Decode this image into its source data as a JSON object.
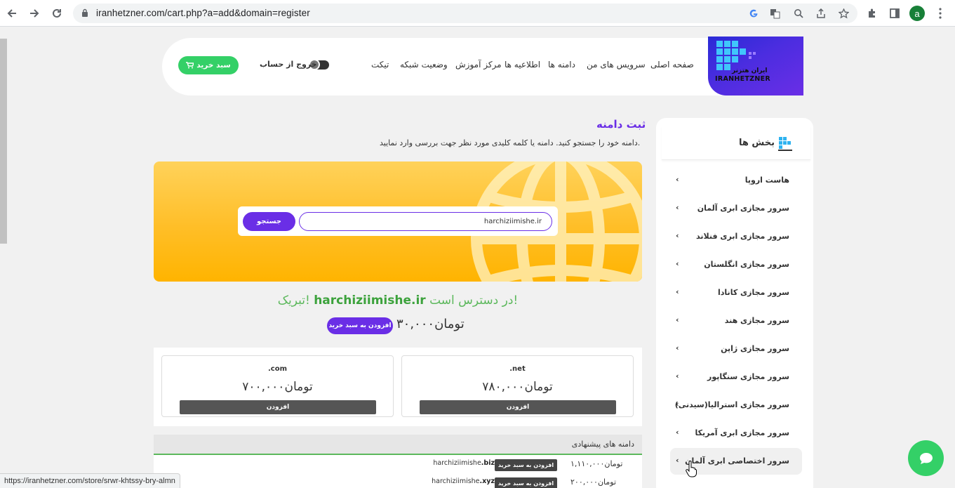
{
  "browser": {
    "url": "iranhetzner.com/cart.php?a=add&domain=register",
    "profile_initial": "a",
    "status_url": "https://iranhetzner.com/store/srwr-khtssy-bry-almn"
  },
  "header": {
    "logo_fa": "ایران هتزنر",
    "logo_en": "IRANHETZNER",
    "menu": [
      "صفحه اصلی",
      "سرویس های من",
      "دامنه ها",
      "اطلاعیه ها",
      "مرکز آموزش",
      "وضعیت شبکه",
      "تیکت"
    ],
    "logout_label": "خروج از حساب",
    "cart_label": "سبد خرید"
  },
  "sidebar": {
    "title": "بخش ها",
    "items": [
      "هاست اروپا",
      "سرور مجازی ابری آلمان",
      "سرور مجازی ابری فنلاند",
      "سرور مجازی انگلستان",
      "سرور مجازی کانادا",
      "سرور مجازی هند",
      "سرور مجازی ژاپن",
      "سرور مجازی سنگاپور",
      "سرور مجازی استرالیا(سیدنی)",
      "سرور مجازی ابری آمریکا",
      "سرور اختصاصی ابری آلمان"
    ]
  },
  "main": {
    "title": "ثبت دامنه",
    "description": "دامنه خود را جستجو کنید. دامنه یا کلمه کلیدی مورد نظر جهت بررسی وارد نمایید.",
    "search_value": "harchiziimishe.ir",
    "search_button": "جستجو",
    "avail_prefix": "تبریک!",
    "avail_domain": "harchiziimishe.ir",
    "avail_suffix": "در دسترس است!",
    "price": "۳۰,۰۰۰تومان",
    "add_to_cart": "افزودن به سبد خرید",
    "tlds": [
      {
        "tld": ".net",
        "price": "۷۸۰,۰۰۰تومان",
        "button": "افزودن"
      },
      {
        "tld": ".com",
        "price": "۷۰۰,۰۰۰تومان",
        "button": "افزودن"
      }
    ],
    "suggestions_title": "دامنه های پیشنهادی",
    "suggestions": [
      {
        "name": "harchiziimishe",
        "tld": ".biz",
        "price": "۱,۱۱۰,۰۰۰تومان",
        "button": "افزودن به سبد خرید"
      },
      {
        "name": "harchiziimishe",
        "tld": ".xyz",
        "price": "۲۰۰,۰۰۰تومان",
        "button": "افزودن به سبد خرید"
      }
    ]
  },
  "colors": {
    "accent_purple": "#6a2ee6",
    "success_green": "#5cb85c",
    "banner_yellow": "#ffbe27",
    "cart_green": "#34d067"
  }
}
